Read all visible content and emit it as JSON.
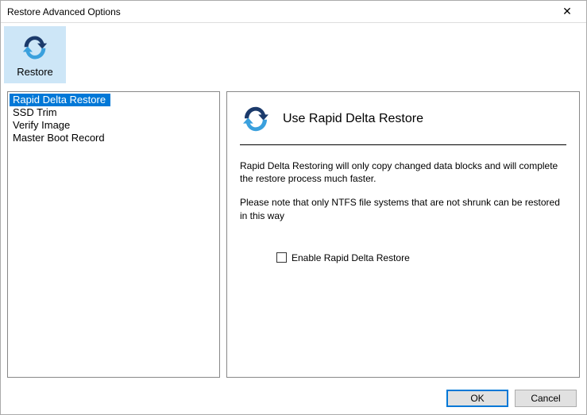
{
  "window": {
    "title": "Restore Advanced Options"
  },
  "toolbar": {
    "restore_label": "Restore"
  },
  "sidebar": {
    "items": [
      {
        "label": "Rapid Delta Restore",
        "selected": true
      },
      {
        "label": "SSD Trim",
        "selected": false
      },
      {
        "label": "Verify Image",
        "selected": false
      },
      {
        "label": "Master Boot Record",
        "selected": false
      }
    ]
  },
  "main": {
    "heading": "Use Rapid Delta Restore",
    "paragraph1": "Rapid Delta Restoring will only copy changed data blocks and will complete the restore process much faster.",
    "paragraph2": "Please note that only NTFS file systems that are not shrunk can be restored in this way",
    "checkbox_label": "Enable Rapid Delta Restore",
    "checkbox_checked": false
  },
  "footer": {
    "ok_label": "OK",
    "cancel_label": "Cancel"
  },
  "colors": {
    "accent": "#0078d7",
    "icon_dark": "#1b3a6b",
    "icon_light": "#3aa0dd"
  }
}
